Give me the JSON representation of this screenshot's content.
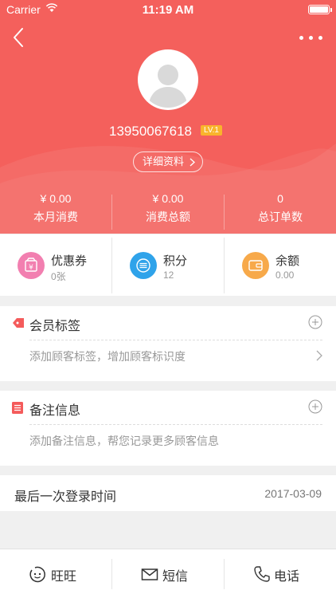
{
  "status_bar": {
    "carrier": "Carrier",
    "time": "11:19 AM"
  },
  "profile": {
    "phone": "13950067618",
    "level": "LV.1",
    "detail_label": "详细资料"
  },
  "stats": [
    {
      "value": "¥ 0.00",
      "label": "本月消费"
    },
    {
      "value": "¥ 0.00",
      "label": "消费总额"
    },
    {
      "value": "0",
      "label": "总订单数"
    }
  ],
  "assets": [
    {
      "title": "优惠券",
      "sub": "0张",
      "color": "#f27fb0",
      "icon": "coupon-icon"
    },
    {
      "title": "积分",
      "sub": "12",
      "color": "#2fa3ea",
      "icon": "points-icon"
    },
    {
      "title": "余额",
      "sub": "0.00",
      "color": "#f7a94a",
      "icon": "wallet-icon"
    }
  ],
  "tags_card": {
    "title": "会员标签",
    "hint": "添加顾客标签，增加顾客标识度"
  },
  "notes_card": {
    "title": "备注信息",
    "hint": "添加备注信息，帮您记录更多顾客信息"
  },
  "last_login": {
    "label": "最后一次登录时间",
    "date": "2017-03-09"
  },
  "tabbar": [
    {
      "label": "旺旺",
      "icon": "wangwang-icon"
    },
    {
      "label": "短信",
      "icon": "envelope-icon"
    },
    {
      "label": "电话",
      "icon": "phone-icon"
    }
  ],
  "colors": {
    "header": "#f4605c",
    "level_badge": "#f9b42c",
    "tag_icon": "#f45b5b"
  }
}
